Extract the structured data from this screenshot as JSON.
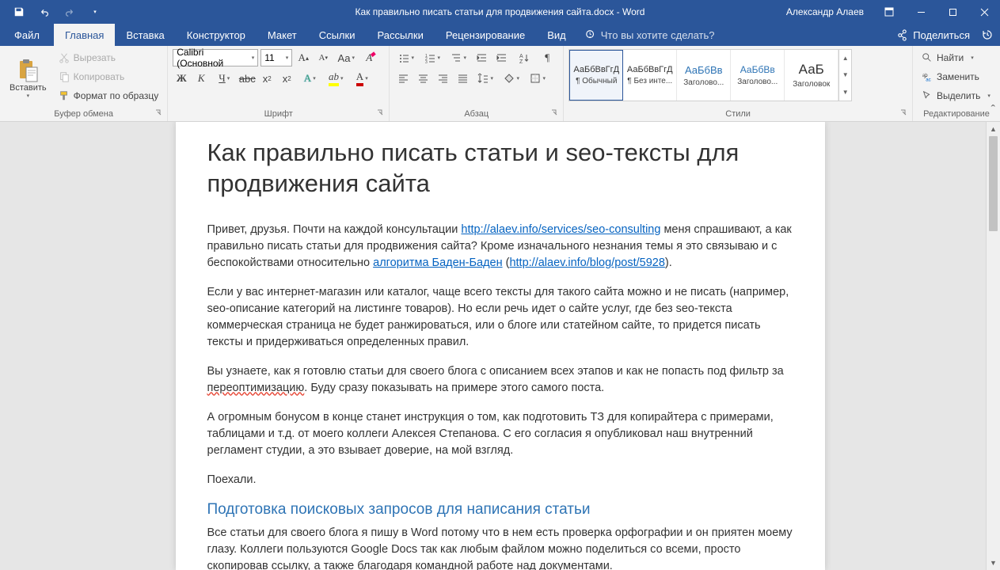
{
  "titlebar": {
    "doc_title": "Как правильно писать статьи для продвижения сайта.docx  -  Word",
    "user": "Александр Алаев"
  },
  "tabs": {
    "file": "Файл",
    "home": "Главная",
    "insert": "Вставка",
    "design": "Конструктор",
    "layout": "Макет",
    "references": "Ссылки",
    "mailings": "Рассылки",
    "review": "Рецензирование",
    "view": "Вид",
    "tell_me": "Что вы хотите сделать?",
    "share": "Поделиться"
  },
  "clipboard": {
    "group": "Буфер обмена",
    "paste": "Вставить",
    "cut": "Вырезать",
    "copy": "Копировать",
    "format_painter": "Формат по образцу"
  },
  "font": {
    "group": "Шрифт",
    "name": "Calibri (Основной",
    "size": "11"
  },
  "paragraph": {
    "group": "Абзац"
  },
  "styles": {
    "group": "Стили",
    "preview": "АаБбВвГгД",
    "preview_h": "АаБбВв",
    "preview_t": "АаБ",
    "normal": "¶ Обычный",
    "no_spacing": "¶ Без инте...",
    "heading1": "Заголово...",
    "heading2": "Заголово...",
    "title": "Заголовок"
  },
  "editing": {
    "group": "Редактирование",
    "find": "Найти",
    "replace": "Заменить",
    "select": "Выделить"
  },
  "document": {
    "title": "Как правильно писать статьи и seo-тексты для продвижения сайта",
    "p1a": "Привет, друзья. Почти на каждой консультации ",
    "p1_link1": "http://alaev.info/services/seo-consulting",
    "p1b": " меня спрашивают, а как правильно писать статьи для продвижения сайта? Кроме изначального незнания темы я это связываю и с беспокойствами относительно ",
    "p1_link2": "алгоритма Баден-Баден",
    "p1c": " (",
    "p1_link3": "http://alaev.info/blog/post/5928",
    "p1d": ").",
    "p2": "Если у вас интернет-магазин или каталог, чаще всего тексты для такого сайта можно и не писать (например, seo-описание категорий на листинге товаров). Но если речь идет о сайте услуг, где без seo-текста коммерческая страница не будет ранжироваться, или о блоге или статейном сайте, то придется писать тексты и придерживаться определенных правил.",
    "p3a": "Вы узнаете, как я готовлю статьи для своего блога с описанием всех этапов и как не попасть под фильтр за ",
    "p3_wavy": "переоптимизацию",
    "p3b": ". Буду сразу показывать на примере этого самого поста.",
    "p4": "А огромным бонусом в конце станет инструкция о том, как подготовить ТЗ для копирайтера с примерами, таблицами и т.д. от моего коллеги Алексея Степанова. С его согласия я опубликовал наш внутренний регламент студии, а это взывает доверие, на мой взгляд.",
    "p5": "Поехали.",
    "h2": "Подготовка поисковых запросов для написания статьи",
    "p6": "Все статьи для своего блога я пишу в Word потому что в нем есть проверка орфографии и он приятен моему глазу. Коллеги пользуются Google Docs так как любым файлом можно поделиться со всеми, просто скопировав ссылку, а также благодаря командной работе над документами."
  }
}
